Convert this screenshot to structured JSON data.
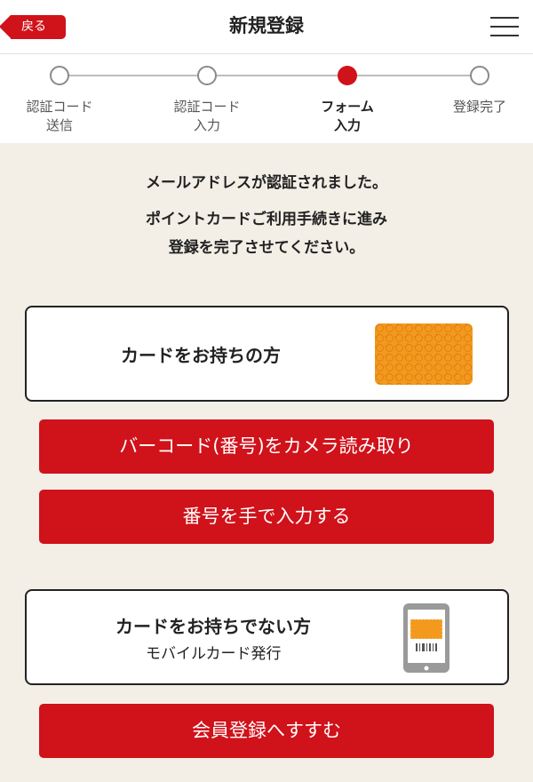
{
  "header": {
    "back_label": "戻る",
    "title": "新規登録"
  },
  "stepper": {
    "steps": [
      {
        "label": "認証コード\n送信",
        "state": "done"
      },
      {
        "label": "認証コード\n入力",
        "state": "done"
      },
      {
        "label": "フォーム\n入力",
        "state": "current"
      },
      {
        "label": "登録完了",
        "state": "pending"
      }
    ]
  },
  "intro": {
    "line1": "メールアドレスが認証されました。",
    "line2": "ポイントカードご利用手続きに進み",
    "line3": "登録を完了させてください。"
  },
  "has_card": {
    "title": "カードをお持ちの方",
    "card_icon": "orange-card-icon",
    "barcode_button": "バーコード(番号)をカメラ読み取り",
    "manual_button": "番号を手で入力する"
  },
  "no_card": {
    "title": "カードをお持ちでない方",
    "subtitle": "モバイルカード発行",
    "phone_icon": "mobile-card-phone-icon",
    "register_button": "会員登録へすすむ"
  },
  "colors": {
    "accent": "#d0121b",
    "background": "#f3efe7",
    "card_orange": "#f39a1e"
  }
}
